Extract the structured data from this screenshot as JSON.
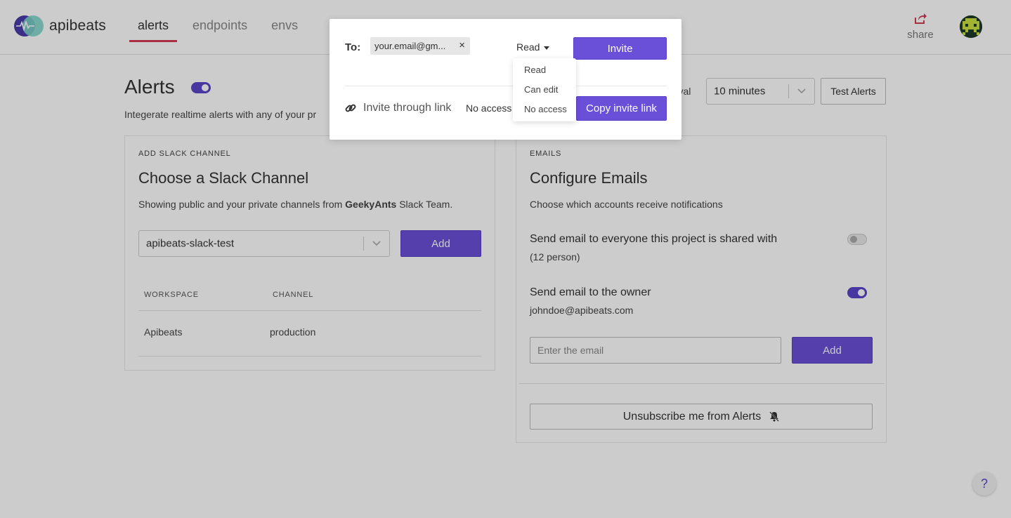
{
  "header": {
    "app_name": "apibeats",
    "tabs": [
      {
        "label": "alerts",
        "active": true
      },
      {
        "label": "endpoints",
        "active": false
      },
      {
        "label": "envs",
        "active": false
      }
    ],
    "share_label": "share"
  },
  "page": {
    "title": "Alerts",
    "alerts_enabled": true,
    "subtitle": "Integerate realtime alerts with any of your pr",
    "interval_label": "erval",
    "interval_value": "10 minutes",
    "test_button": "Test Alerts"
  },
  "slack_card": {
    "kicker": "ADD SLACK CHANNEL",
    "title": "Choose a Slack Channel",
    "desc_prefix": "Showing public and your private channels from ",
    "desc_team": "GeekyAnts",
    "desc_suffix": " Slack Team.",
    "channel_select": "apibeats-slack-test",
    "add_button": "Add",
    "table": {
      "headers": [
        "WORKSPACE",
        "CHANNEL"
      ],
      "rows": [
        [
          "Apibeats",
          "production"
        ]
      ]
    }
  },
  "emails_card": {
    "kicker": "EMAILS",
    "title": "Configure Emails",
    "desc": "Choose which accounts receive notifications",
    "option_everyone": {
      "label": "Send email to everyone this project is shared with",
      "sub": "(12 person)",
      "enabled": false
    },
    "option_owner": {
      "label": "Send email to the owner",
      "sub": "johndoe@apibeats.com",
      "enabled": true
    },
    "email_placeholder": "Enter the email",
    "add_button": "Add",
    "unsubscribe_button": "Unsubscribe me from Alerts"
  },
  "modal": {
    "to_label": "To:",
    "email_chip": "your.email@gm...",
    "chip_remove": "×",
    "permission": "Read",
    "invite_button": "Invite",
    "link_label": "Invite through link",
    "link_permission": "No access",
    "copy_button": "Copy invite link",
    "dropdown_options": [
      "Read",
      "Can edit",
      "No access"
    ]
  },
  "help_label": "?",
  "colors": {
    "primary": "#6a4fd8",
    "tab_underline": "#d23a55"
  }
}
